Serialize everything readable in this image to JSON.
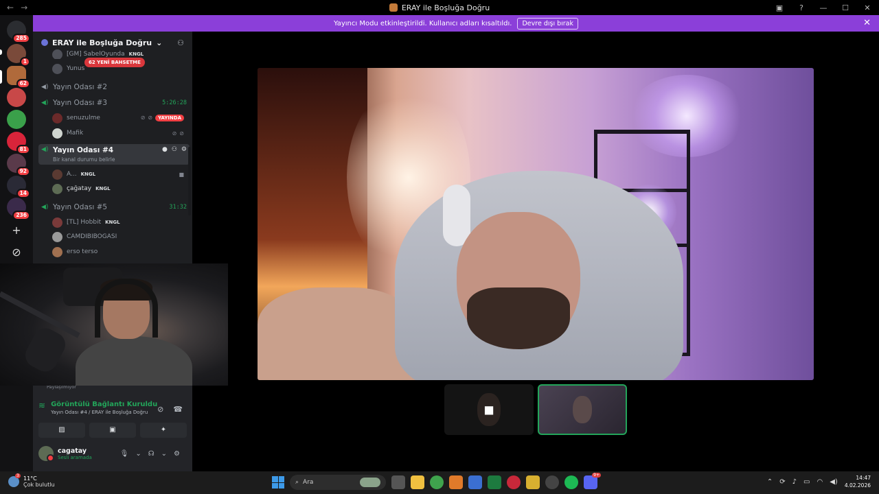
{
  "titlebar": {
    "title": "ERAY ile Boşluğa Doğru",
    "back": "←",
    "forward": "→",
    "inbox_icon": "inbox-icon",
    "help": "?",
    "minimize": "—",
    "maximize": "☐",
    "close": "✕"
  },
  "banner": {
    "text": "Yayıncı Modu etkinleştirildi. Kullanıcı adları kısaltıldı.",
    "button": "Devre dışı bırak",
    "close": "✕"
  },
  "rail": {
    "badges": [
      "285",
      "1",
      "62",
      "81",
      "92",
      "14",
      "236"
    ],
    "add": "+",
    "discover": "⊘"
  },
  "server": {
    "name": "ERAY ile Boşluğa Doğru",
    "chevron": "⌄",
    "invite_icon": "add-member-icon",
    "mention_pill": "62 YENİ BAHSETME"
  },
  "channels": {
    "partial_top_user": "[GM] SabelOyunda",
    "partial_top_tag": "KNGL",
    "yunus": "Yunus",
    "room2": "Yayın Odası #2",
    "room3": "Yayın Odası #3",
    "room3_timer": "5:26:28",
    "senuzulme": "senuzulme",
    "live_label": "YAYINDA",
    "mafik": "Mafik",
    "room4": "Yayın Odası #4",
    "room4_sub": "Bir kanal durumu belirle",
    "a_user": "A...",
    "a_user_tag": "KNGL",
    "cagatay": "çağatay",
    "cagatay_tag": "KNGL",
    "room5": "Yayın Odası #5",
    "room5_timer": "31:32",
    "hobbit": "[TL] Hobbit",
    "hobbit_tag": "KNGL",
    "camdibi": "CAMDIBIBOGASI",
    "erso": "erso terso"
  },
  "voice": {
    "shared": "Paylaşılmıyor",
    "status": "Görüntülü Bağlantı Kuruldu",
    "location": "Yayın Odası #4 / ERAY ile Boşluğa Doğru",
    "user_name": "cagatay",
    "user_status": "Sesli aramada"
  },
  "taskbar": {
    "temp": "11°C",
    "weather": "Çok bulutlu",
    "weather_badge": "3",
    "search": "Ara",
    "discord_badge": "9+",
    "time": "14:47",
    "date": "4.02.2026"
  },
  "colors": {
    "banner": "#8b3fd9",
    "live_green": "#23a55a",
    "danger": "#f23f43",
    "sidebar": "#1e1f22"
  }
}
